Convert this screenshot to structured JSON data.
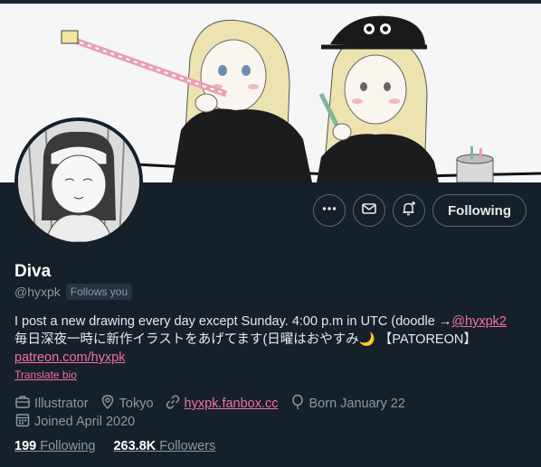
{
  "profile": {
    "name": "Diva",
    "handle": "@hyxpk",
    "follows_you": "Follows you",
    "bio": {
      "line1_text": "I post a new drawing every day except Sunday. 4:00 p.m in UTC (doodle →",
      "line1_mention": "@hyxpk2",
      "line2": "毎日深夜一時に新作イラストをあげてます(日曜はおやすみ🌙 【PATOREON】",
      "line3_link": "patreon.com/hyxpk"
    },
    "translate_bio": "Translate bio",
    "meta": {
      "occupation": "Illustrator",
      "location": "Tokyo",
      "website": "hyxpk.fanbox.cc",
      "birthday": "Born January 22",
      "joined": "Joined April 2020"
    },
    "following_count": "199",
    "following_label": "Following",
    "followers_count": "263.8K",
    "followers_label": "Followers"
  },
  "actions": {
    "more_icon": "more-icon",
    "message_icon": "envelope-icon",
    "notify_icon": "bell-plus-icon",
    "follow_button": "Following"
  },
  "colors": {
    "background": "#15202b",
    "accent": "#f36cae",
    "secondary_text": "#8b98a5"
  }
}
